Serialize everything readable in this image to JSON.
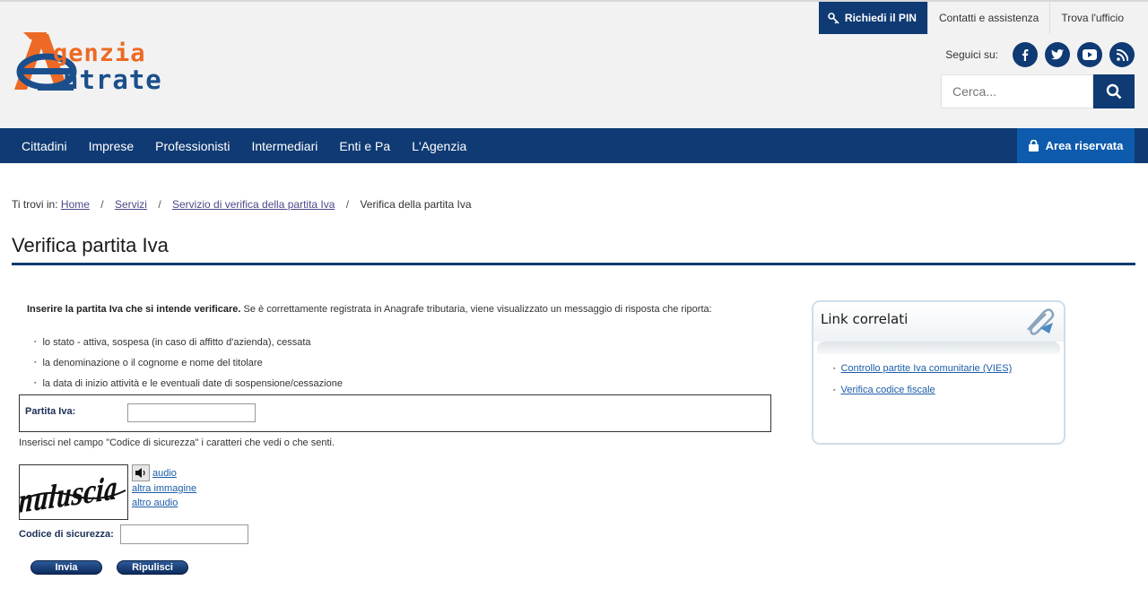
{
  "logo": {
    "line1": "genzia",
    "line2": "ntrate"
  },
  "top_links": {
    "pin": "Richiedi il PIN",
    "contacts": "Contatti e assistenza",
    "office": "Trova l'ufficio"
  },
  "social": {
    "label": "Seguici su:",
    "icons": [
      "facebook-icon",
      "twitter-icon",
      "youtube-icon",
      "rss-icon"
    ]
  },
  "search": {
    "placeholder": "Cerca..."
  },
  "nav": {
    "items": [
      "Cittadini",
      "Imprese",
      "Professionisti",
      "Intermediari",
      "Enti e Pa",
      "L'Agenzia"
    ],
    "area_riservata": "Area riservata"
  },
  "breadcrumb": {
    "prefix": "Ti trovi in:",
    "items": [
      "Home",
      "Servizi",
      "Servizio di verifica della partita Iva"
    ],
    "current": "Verifica della partita Iva"
  },
  "page": {
    "title": "Verifica partita Iva"
  },
  "intro": {
    "bold": "Inserire la partita Iva che si intende verificare.",
    "text": " Se è correttamente registrata in Anagrafe tributaria, viene visualizzato un messaggio di risposta che riporta:",
    "bullets": [
      "lo stato - attiva, sospesa (in caso di affitto d'azienda), cessata",
      "la denominazione o il cognome e nome del titolare",
      "la data di inizio attività e le eventuali date di sospensione/cessazione"
    ]
  },
  "form": {
    "piva_label": "Partita Iva:",
    "piva_value": "",
    "captcha_hint": "Inserisci nel campo \"Codice di sicurezza\" i caratteri che vedi o che senti.",
    "captcha_text": "nuluscia",
    "audio_link": "audio",
    "other_image_link": "altra immagine",
    "other_audio_link": "altro audio",
    "code_label": "Codice di sicurezza:",
    "code_value": "",
    "submit_label": "Invia",
    "reset_label": "Ripulisci"
  },
  "related": {
    "title": "Link correlati",
    "links": [
      "Controllo partite Iva comunitarie (VIES)",
      "Verifica codice fiscale"
    ]
  },
  "colors": {
    "primary": "#0f3a73",
    "accent": "#0e5bad",
    "logo_orange": "#ec6a25"
  }
}
